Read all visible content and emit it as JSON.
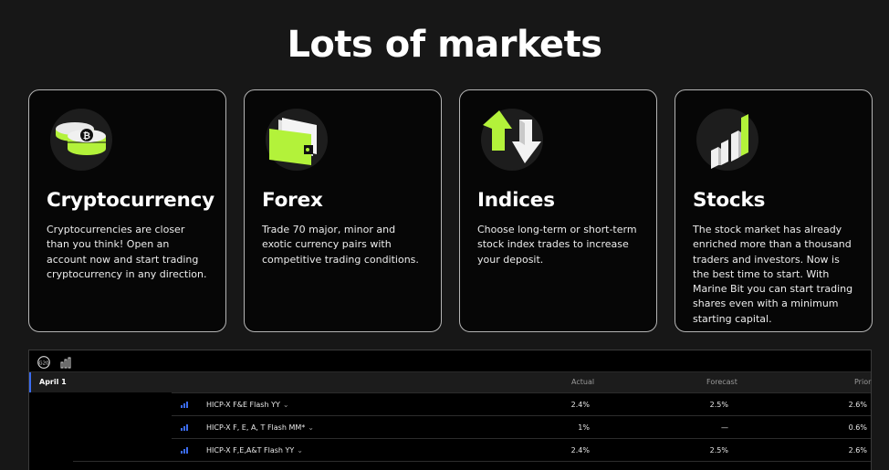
{
  "page": {
    "title": "Lots of markets"
  },
  "cards": [
    {
      "icon": "crypto-coins-icon",
      "title": "Cryptocurrency",
      "text": "Cryptocurrencies are closer than you think! Open an account now and start trading cryptocurrency in any direction."
    },
    {
      "icon": "forex-wallet-icon",
      "title": "Forex",
      "text": "Trade 70 major, minor and exotic currency pairs with competitive trading conditions."
    },
    {
      "icon": "indices-arrows-icon",
      "title": "Indices",
      "text": "Choose long-term or short-term stock index trades to increase your deposit."
    },
    {
      "icon": "stocks-bars-icon",
      "title": "Stocks",
      "text": "The stock market has already enriched more than a thousand traders and investors. Now is the best time to start. With Marine Bit you can start trading shares even with a minimum starting capital."
    }
  ],
  "calendar": {
    "toolbar": {
      "g20_label": "G20",
      "icons": [
        "g20-icon",
        "chart-bars-icon"
      ]
    },
    "header": {
      "date": "April 1",
      "actual": "Actual",
      "forecast": "Forecast",
      "prior": "Prior"
    },
    "rows": [
      {
        "name": "HICP-X F&E Flash YY",
        "actual": "2.4%",
        "forecast": "2.5%",
        "prior": "2.6%"
      },
      {
        "name": "HICP-X F, E, A, T Flash MM*",
        "actual": "1%",
        "forecast": "—",
        "prior": "0.6%"
      },
      {
        "name": "HICP-X F,E,A&T Flash YY",
        "actual": "2.4%",
        "forecast": "2.5%",
        "prior": "2.6%"
      }
    ],
    "chevron": "⌄"
  },
  "colors": {
    "accent": "#b3f23a",
    "blue": "#3b6cf0",
    "background": "#171717"
  }
}
